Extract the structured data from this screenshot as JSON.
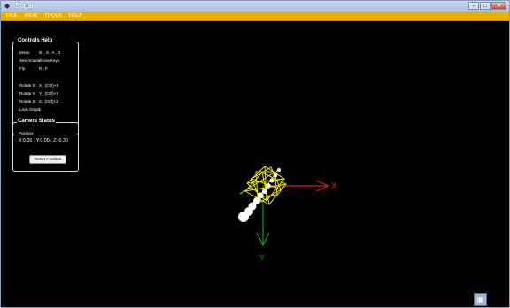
{
  "window": {
    "title": "Sugar",
    "controls": {
      "minimize": "–",
      "maximize": "□",
      "close": "✕"
    }
  },
  "menu": {
    "items": [
      "FILE",
      "VIEW",
      "TOOLS",
      "HELP"
    ]
  },
  "controls_help": {
    "title": "Controls Help",
    "rows": [
      {
        "label": "Move:",
        "value": "W , S , A , D"
      },
      {
        "label": "See Around:",
        "value": "Arrow Keys"
      },
      {
        "label": "Fly:",
        "value": "R , F"
      },
      {
        "label": "Rotate X:",
        "value": "X , (Ctrl)+X"
      },
      {
        "label": "Rotate Y:",
        "value": "Y , (Ctrl)+Y"
      },
      {
        "label": "Rotate Z:",
        "value": "Z , (Ctrl)+Z"
      },
      {
        "label": "Look Origin:",
        "value": "L"
      }
    ]
  },
  "camera_status": {
    "title": "Camera Status",
    "position_label": "Position:",
    "position_value": "X:0.00 , Y:0.00 , Z:-0.30",
    "reset_button": "Reset Position"
  },
  "scene": {
    "axis_x_label": "X",
    "axis_y_label": "Y",
    "colors": {
      "x_axis": "#d02020",
      "y_axis": "#18a018",
      "molecule": "#e8e000",
      "atoms": "#ffffff"
    }
  },
  "corner_button": {
    "icon": "window-icon"
  }
}
